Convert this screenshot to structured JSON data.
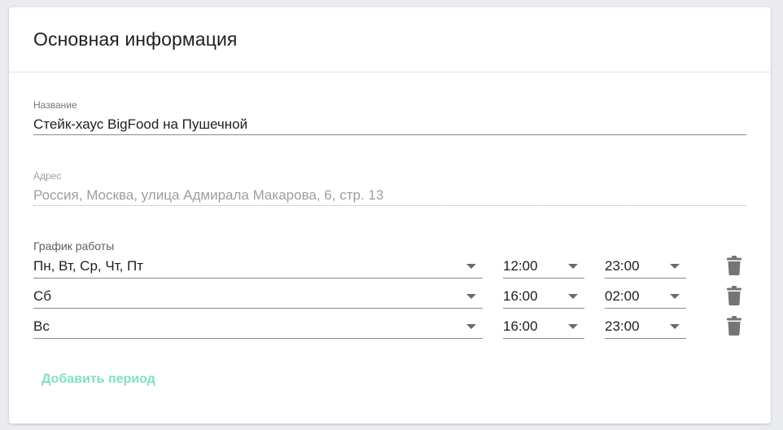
{
  "header": {
    "title": "Основная информация"
  },
  "name_field": {
    "label": "Название",
    "value": "Стейк-хаус BigFood на Пушечной"
  },
  "address_field": {
    "label": "Адрес",
    "value": "Россия, Москва, улица Адмирала Макарова, 6, стр. 13"
  },
  "schedule": {
    "label": "График работы",
    "rows": [
      {
        "days": "Пн, Вт, Ср, Чт, Пт",
        "from": "12:00",
        "to": "23:00"
      },
      {
        "days": "Сб",
        "from": "16:00",
        "to": "02:00"
      },
      {
        "days": "Вс",
        "from": "16:00",
        "to": "23:00"
      }
    ],
    "add_label": "Добавить период"
  },
  "icons": {
    "dropdown": "chevron-down-icon",
    "delete": "trash-icon"
  },
  "colors": {
    "accent": "#7fe0c2",
    "icon": "#757575"
  }
}
